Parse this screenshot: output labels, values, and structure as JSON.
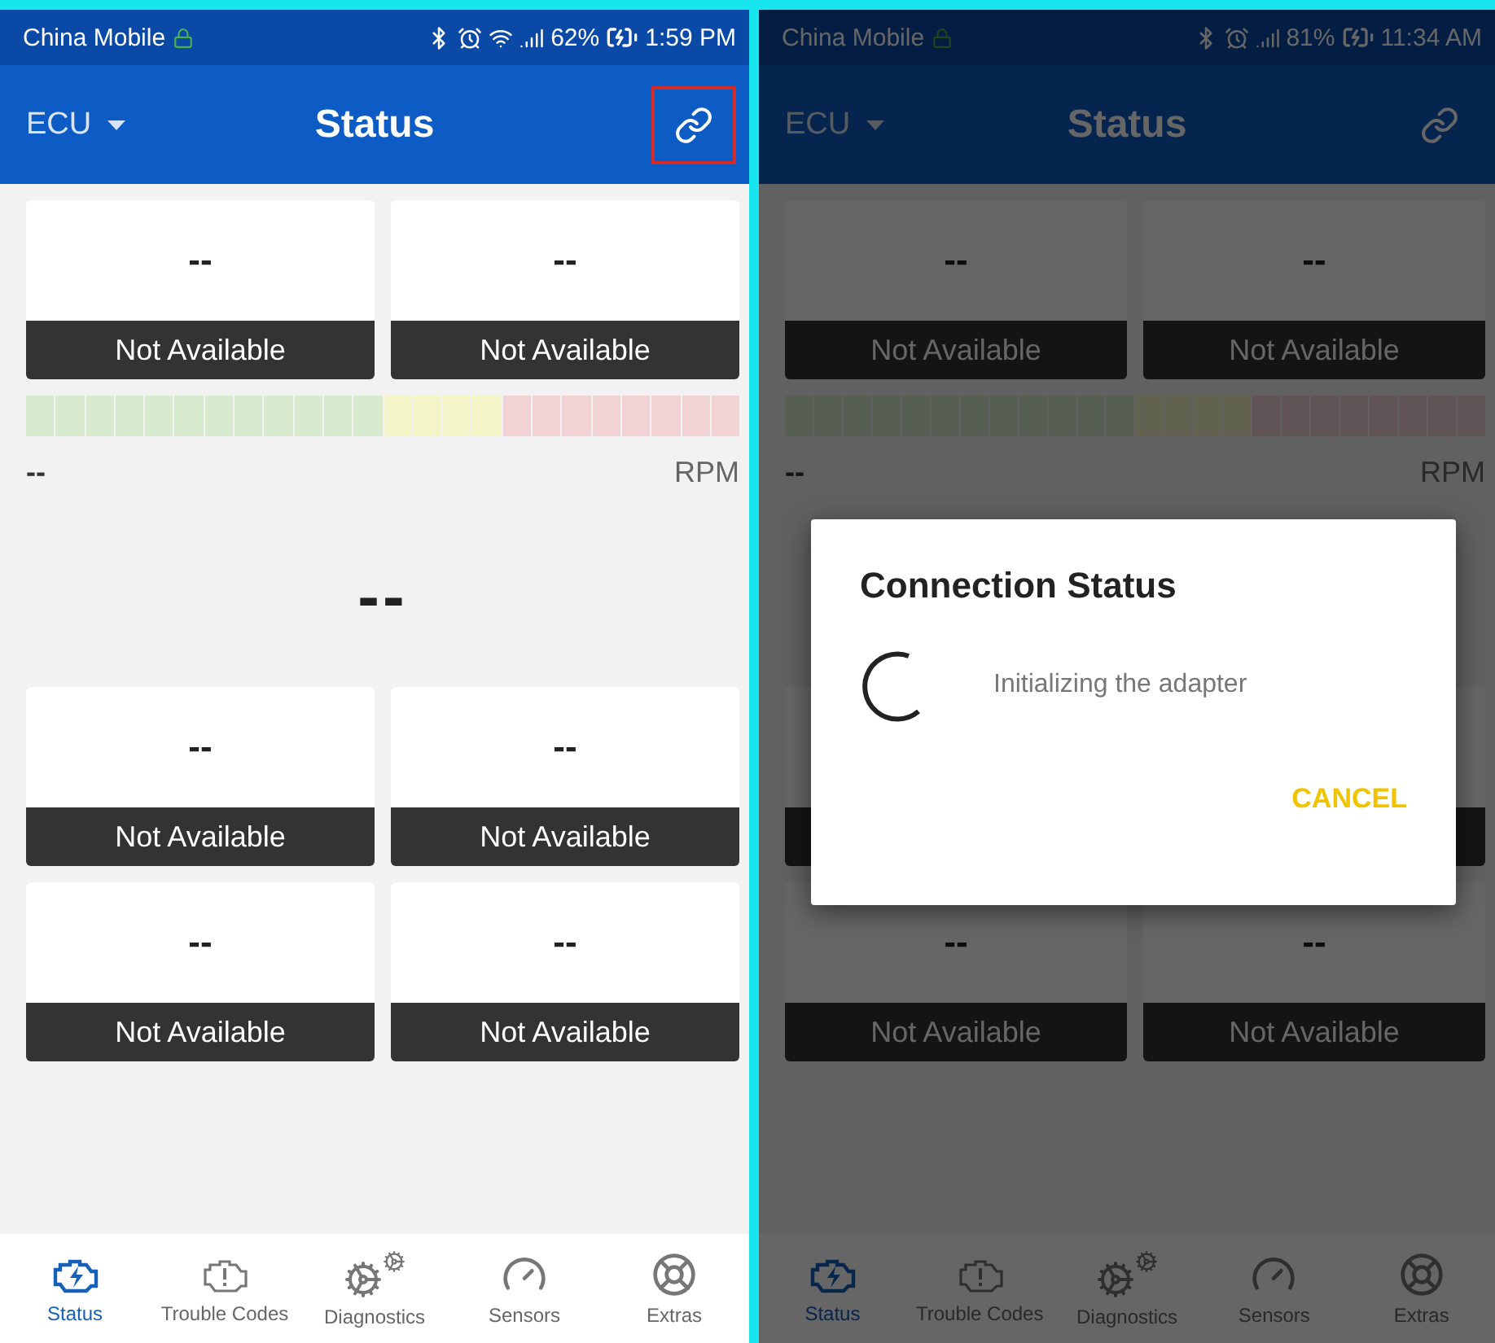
{
  "screens": [
    {
      "dimmed": false,
      "status_bar": {
        "carrier": "China Mobile",
        "battery": "62%",
        "time": "1:59 PM",
        "wifi": true
      },
      "app_bar": {
        "selector": "ECU",
        "title": "Status",
        "link_highlighted": true
      },
      "card_rows": [
        [
          {
            "value": "--",
            "label": "Not Available"
          },
          {
            "value": "--",
            "label": "Not Available"
          }
        ]
      ],
      "rpm": {
        "value": "--",
        "unit": "RPM"
      },
      "big_reading": "--",
      "lower_card_rows": [
        [
          {
            "value": "--",
            "label": "Not Available"
          },
          {
            "value": "--",
            "label": "Not Available"
          }
        ],
        [
          {
            "value": "--",
            "label": "Not Available"
          },
          {
            "value": "--",
            "label": "Not Available"
          }
        ]
      ],
      "nav": [
        {
          "label": "Status",
          "selected": true
        },
        {
          "label": "Trouble Codes",
          "selected": false
        },
        {
          "label": "Diagnostics",
          "selected": false
        },
        {
          "label": "Sensors",
          "selected": false
        },
        {
          "label": "Extras",
          "selected": false
        }
      ]
    },
    {
      "dimmed": true,
      "status_bar": {
        "carrier": "China Mobile",
        "battery": "81%",
        "time": "11:34 AM",
        "wifi": false
      },
      "app_bar": {
        "selector": "ECU",
        "title": "Status",
        "link_highlighted": false
      },
      "card_rows": [
        [
          {
            "value": "--",
            "label": "Not Available"
          },
          {
            "value": "--",
            "label": "Not Available"
          }
        ]
      ],
      "rpm": {
        "value": "--",
        "unit": "RPM"
      },
      "lower_card_rows": [
        [
          {},
          {}
        ],
        [
          {
            "value": "--",
            "label": "Not Available"
          },
          {
            "value": "--",
            "label": "Not Available"
          }
        ]
      ],
      "nav": [
        {
          "label": "Status",
          "selected": true
        },
        {
          "label": "Trouble Codes",
          "selected": false
        },
        {
          "label": "Diagnostics",
          "selected": false
        },
        {
          "label": "Sensors",
          "selected": false
        },
        {
          "label": "Extras",
          "selected": false
        }
      ],
      "dialog": {
        "title": "Connection Status",
        "message": "Initializing the adapter",
        "button": "CANCEL"
      }
    }
  ]
}
